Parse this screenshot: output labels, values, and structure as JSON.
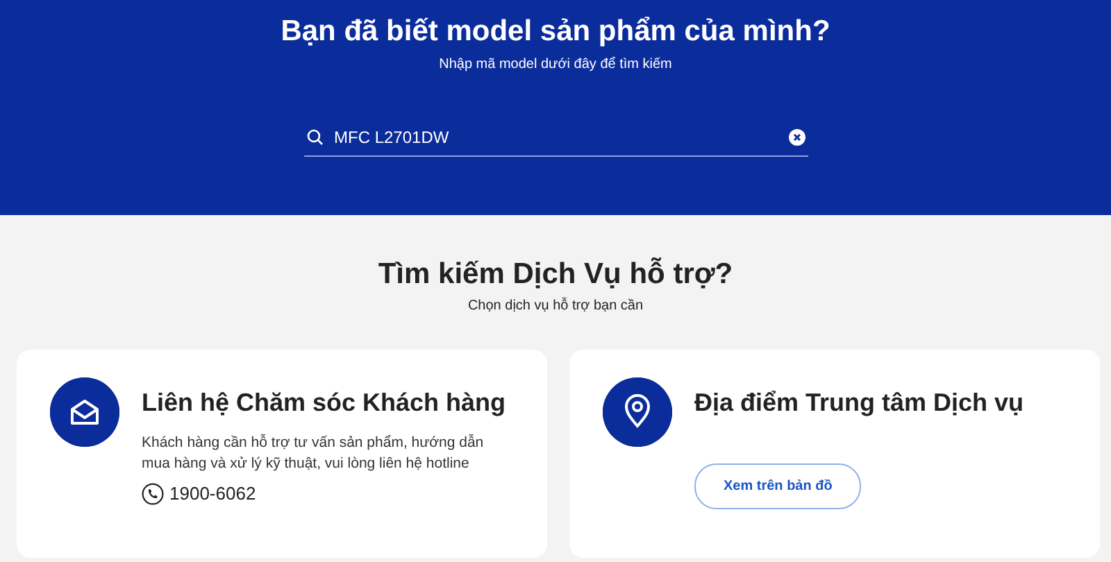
{
  "hero": {
    "title": "Bạn đã biết model sản phẩm của mình?",
    "subtitle": "Nhập mã model dưới đây để tìm kiếm",
    "search": {
      "value": "MFC L2701DW"
    }
  },
  "services": {
    "title": "Tìm kiếm Dịch Vụ hỗ trợ?",
    "subtitle": "Chọn dịch vụ hỗ trợ bạn cần",
    "cards": [
      {
        "kind": "contact",
        "title": "Liên hệ Chăm sóc Khách hàng",
        "description": "Khách hàng cần hỗ trợ tư vấn sản phẩm, hướng dẫn mua hàng và xử lý kỹ thuật, vui lòng liên hệ hotline",
        "hotline": "1900-6062"
      },
      {
        "kind": "location",
        "title": "Địa điểm Trung tâm Dịch vụ",
        "button": "Xem trên bản đồ"
      }
    ]
  }
}
